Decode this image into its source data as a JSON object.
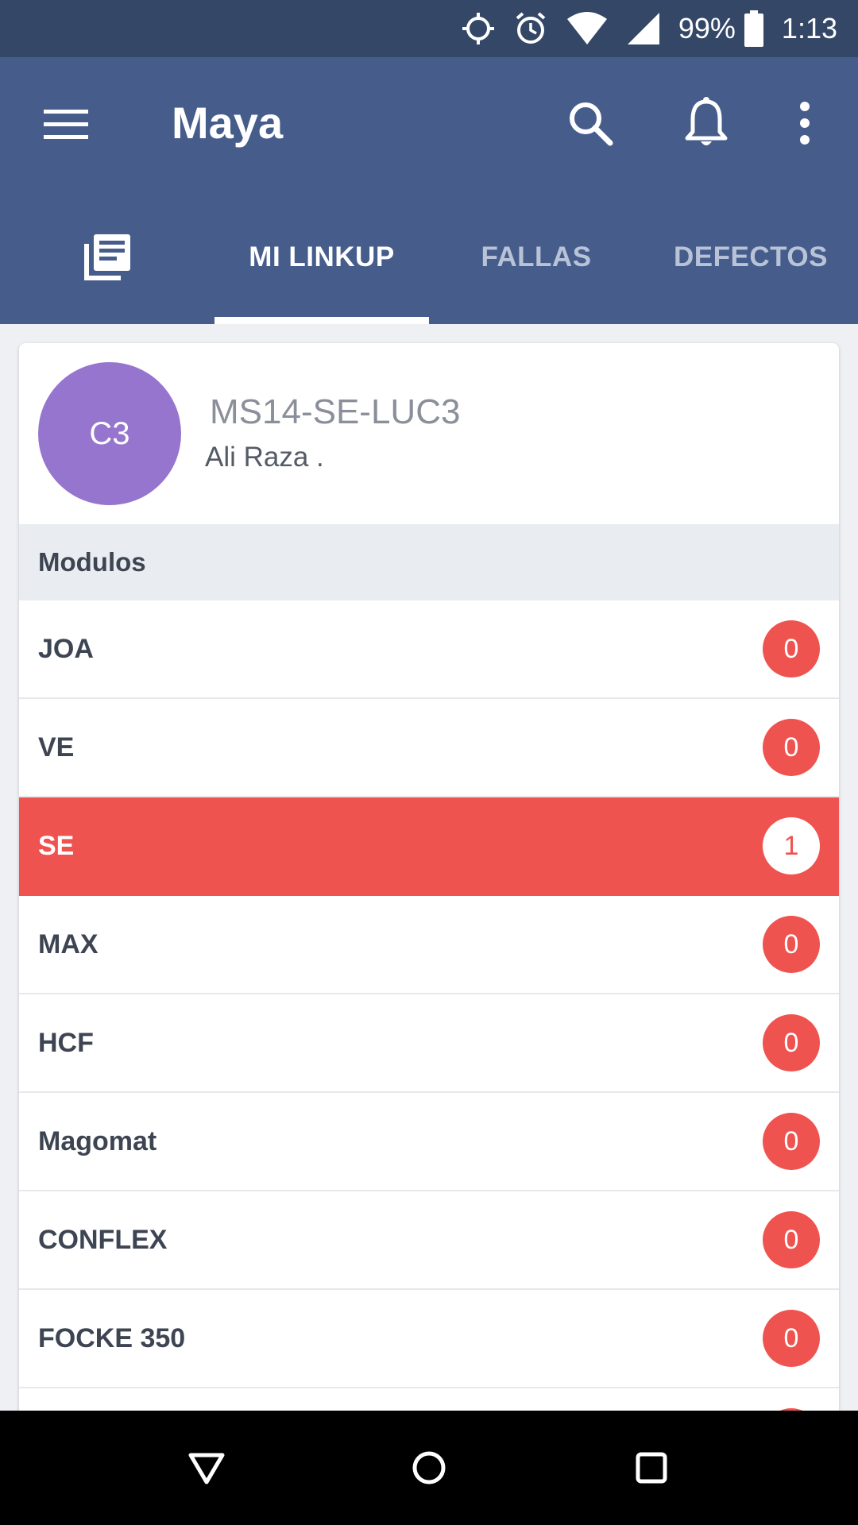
{
  "status_bar": {
    "battery": "99%",
    "time": "1:13",
    "icons": [
      "location-icon",
      "alarm-icon",
      "wifi-icon",
      "signal-icon",
      "battery-icon"
    ]
  },
  "toolbar": {
    "title": "Maya",
    "icons": [
      "menu-icon",
      "search-icon",
      "bell-icon",
      "more-vert-icon"
    ]
  },
  "tabs": [
    {
      "icon": "news-icon",
      "label": ""
    },
    {
      "label": "MI LINKUP",
      "active": true
    },
    {
      "label": "FALLAS"
    },
    {
      "label": "DEFECTOS"
    }
  ],
  "profile": {
    "avatar_initials": "C3",
    "avatar_color": "#9575cd",
    "device": "MS14-SE-LUC3",
    "user": "Ali Raza ."
  },
  "modules": {
    "header": "Modulos",
    "items": [
      {
        "name": "JOA",
        "count": "0"
      },
      {
        "name": "VE",
        "count": "0"
      },
      {
        "name": "SE",
        "count": "1",
        "highlighted": true
      },
      {
        "name": "MAX",
        "count": "0"
      },
      {
        "name": "HCF",
        "count": "0"
      },
      {
        "name": "Magomat",
        "count": "0"
      },
      {
        "name": "CONFLEX",
        "count": "0"
      },
      {
        "name": "FOCKE 350",
        "count": "0"
      }
    ]
  },
  "colors": {
    "app_bar": "#465d8c",
    "status_bar": "#344767",
    "accent_red": "#ef5350"
  },
  "nav_bar": {
    "icons": [
      "back-icon",
      "home-icon",
      "recents-icon"
    ]
  }
}
